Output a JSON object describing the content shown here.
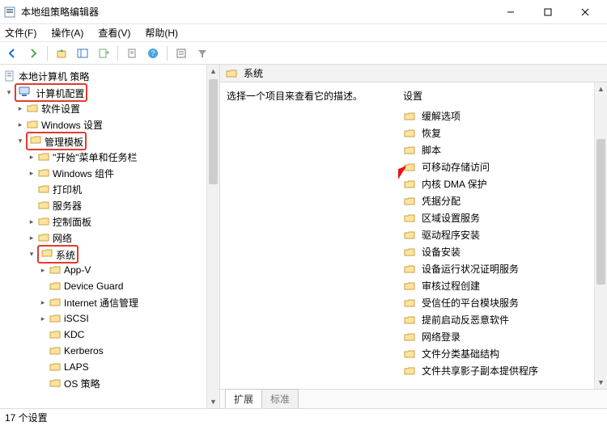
{
  "window": {
    "title": "本地组策略编辑器",
    "min": "—",
    "max": "▢",
    "close": "✕"
  },
  "menu": {
    "file": "文件(F)",
    "action": "操作(A)",
    "view": "查看(V)",
    "help": "帮助(H)"
  },
  "tree": {
    "root": "本地计算机 策略",
    "computer_config": "计算机配置",
    "software_settings": "软件设置",
    "windows_settings": "Windows 设置",
    "admin_templates": "管理模板",
    "start_taskbar": "\"开始\"菜单和任务栏",
    "windows_components": "Windows 组件",
    "printers": "打印机",
    "server": "服务器",
    "control_panel": "控制面板",
    "network": "网络",
    "system": "系统",
    "app_v": "App-V",
    "device_guard": "Device Guard",
    "internet_comm": "Internet 通信管理",
    "iscsi": "iSCSI",
    "kdc": "KDC",
    "kerberos": "Kerberos",
    "laps": "LAPS",
    "os_policy": "OS 策略"
  },
  "rightHeader": "系统",
  "description": "选择一个项目来查看它的描述。",
  "listHeader": "设置",
  "items": [
    "缓解选项",
    "恢复",
    "脚本",
    "可移动存储访问",
    "内核 DMA 保护",
    "凭据分配",
    "区域设置服务",
    "驱动程序安装",
    "设备安装",
    "设备运行状况证明服务",
    "审核过程创建",
    "受信任的平台模块服务",
    "提前启动反恶意软件",
    "网络登录",
    "文件分类基础结构",
    "文件共享影子副本提供程序"
  ],
  "tabs": {
    "extended": "扩展",
    "standard": "标准"
  },
  "status": "17 个设置"
}
